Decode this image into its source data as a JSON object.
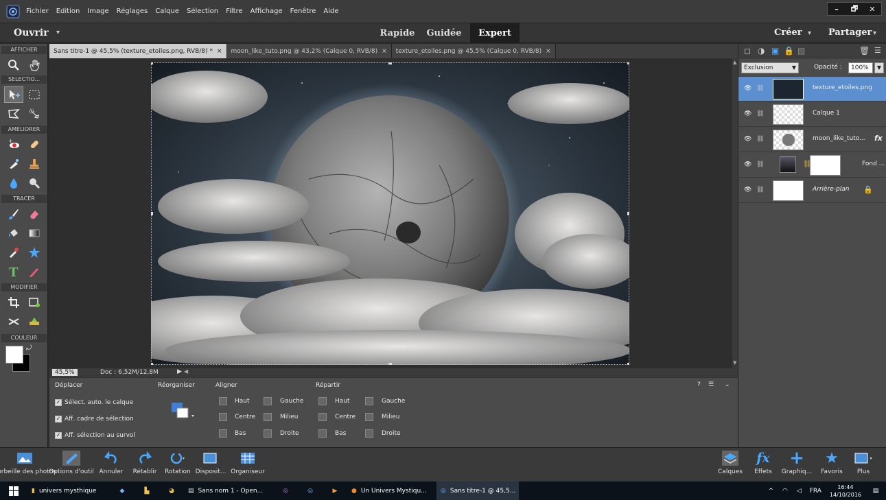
{
  "menu": {
    "items": [
      "Fichier",
      "Edition",
      "Image",
      "Réglages",
      "Calque",
      "Sélection",
      "Filtre",
      "Affichage",
      "Fenêtre",
      "Aide"
    ],
    "window_controls": {
      "minimize": "–",
      "restore": "🗗",
      "close": "✕"
    }
  },
  "modebar": {
    "open": "Ouvrir",
    "modes": [
      "Rapide",
      "Guidée",
      "Expert"
    ],
    "active_mode": "Expert",
    "create": "Créer",
    "share": "Partager"
  },
  "toolbox": {
    "sections": [
      "AFFICHER",
      "SELECTIO...",
      "AMELIORER",
      "TRACER",
      "MODIFIER",
      "COULEUR"
    ]
  },
  "tabs": [
    {
      "label": "Sans titre-1 @ 45,5% (texture_etoiles.png, RVB/8) *",
      "close": "×"
    },
    {
      "label": "moon_like_tuto.png @ 43,2% (Calque 0, RVB/8)",
      "close": "×"
    },
    {
      "label": "texture_etoiles.png @ 45,5% (Calque 0, RVB/8)",
      "close": "×"
    }
  ],
  "status": {
    "zoom": "45,5%",
    "doc": "Doc : 6,52M/12,8M"
  },
  "options": {
    "move_title": "Déplacer",
    "arrange_title": "Réorganiser",
    "align_title": "Aligner",
    "distribute_title": "Répartir",
    "checkboxes": [
      "Sélect. auto. le calque",
      "Aff. cadre de sélection",
      "Aff. sélection au survol"
    ],
    "align": [
      "Haut",
      "Centre",
      "Bas",
      "Gauche",
      "Milieu",
      "Droite"
    ],
    "distribute": [
      "Haut",
      "Centre",
      "Bas",
      "Gauche",
      "Milieu",
      "Droite"
    ]
  },
  "layers": {
    "blend_mode": "Exclusion",
    "opacity_label": "Opacité :",
    "opacity_value": "100%",
    "items": [
      {
        "name": "texture_etoiles.png"
      },
      {
        "name": "Calque 1"
      },
      {
        "name": "moon_like_tuto..."
      },
      {
        "name": "Fond ..."
      },
      {
        "name": "Arrière-plan"
      }
    ],
    "fx": "fx"
  },
  "bottombar": {
    "left": [
      "Corbeille des photos",
      "Options d'outil",
      "Annuler",
      "Rétablir",
      "Rotation",
      "Disposit...",
      "Organiseur"
    ],
    "right": [
      "Calques",
      "Effets",
      "Graphiq...",
      "Favoris",
      "Plus"
    ]
  },
  "taskbar": {
    "items": [
      "univers mysthique",
      "Sans nom 1 - Open...",
      "Un Univers Mystiqu...",
      "Sans titre-1 @ 45,5..."
    ],
    "lang": "FRA",
    "time": "16:44",
    "date": "14/10/2016"
  }
}
